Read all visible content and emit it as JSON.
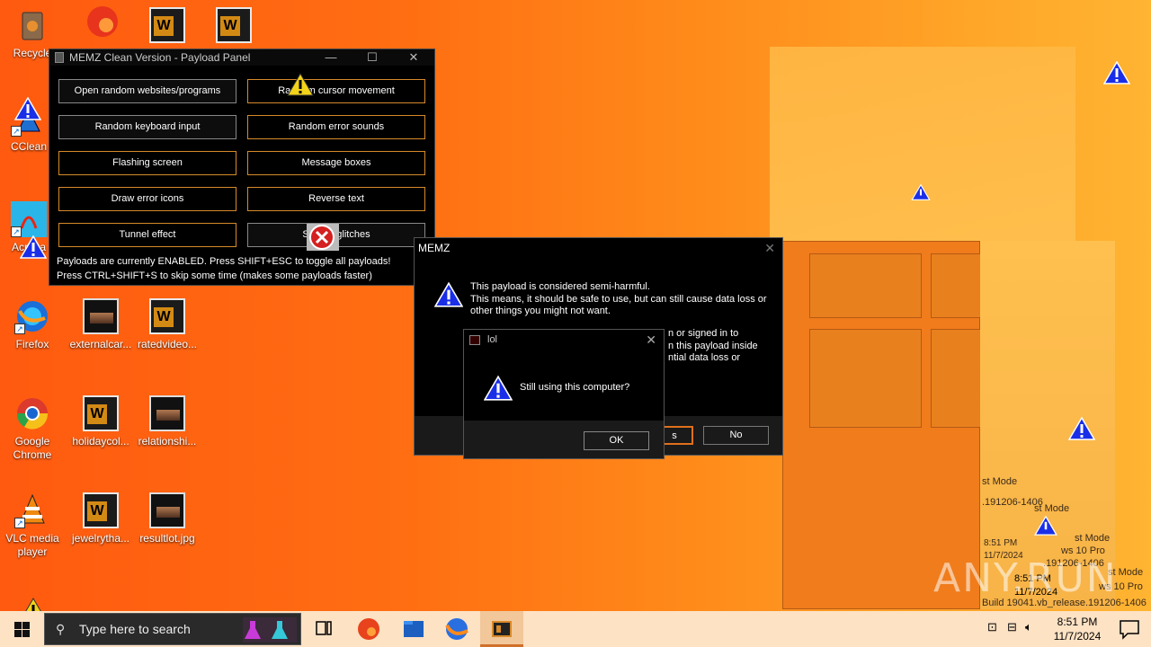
{
  "desktop": {
    "icons": [
      {
        "label": "Recycle",
        "icon": "recycle-bin-icon"
      },
      {
        "label": "CClean",
        "icon": "ccleaner-icon"
      },
      {
        "label": "Acroba",
        "icon": "acrobat-icon"
      },
      {
        "label": "Firefox",
        "icon": "firefox-icon"
      },
      {
        "label": "externalcar...",
        "icon": "image-file-icon"
      },
      {
        "label": "ratedvideo...",
        "icon": "word-doc-icon"
      },
      {
        "label": "Google Chrome",
        "icon": "chrome-icon"
      },
      {
        "label": "holidaycol...",
        "icon": "word-doc-icon"
      },
      {
        "label": "relationshi...",
        "icon": "image-file-icon"
      },
      {
        "label": "VLC media player",
        "icon": "vlc-icon"
      },
      {
        "label": "jewelrytha...",
        "icon": "word-doc-icon"
      },
      {
        "label": "resultlot.jpg",
        "icon": "image-file-icon"
      }
    ]
  },
  "panel": {
    "title": "MEMZ Clean Version - Payload Panel",
    "buttons": [
      "Open random websites/programs",
      "Random cursor movement",
      "Random keyboard input",
      "Random error sounds",
      "Flashing screen",
      "Message boxes",
      "Draw error icons",
      "Reverse text",
      "Tunnel effect",
      "Screen glitches"
    ],
    "status_line1": "Payloads are currently ENABLED. Press SHIFT+ESC to toggle all payloads!",
    "status_line2": "Press CTRL+SHIFT+S to skip some time (makes some payloads faster)"
  },
  "memz_dialog": {
    "title": "MEMZ",
    "message": "This payload is considered semi-harmful.\nThis means, it should be safe to use, but can still cause data loss or other things you might not want.",
    "message_partial": "n or signed in to\nn this payload inside\nntial data loss or",
    "yes_partial": "s",
    "no_label": "No"
  },
  "lol_dialog": {
    "title": "lol",
    "question": "Still using this computer?",
    "ok_label": "OK"
  },
  "taskbar": {
    "search_placeholder": "Type here to search",
    "time": "8:51 PM",
    "date": "11/7/2024"
  },
  "ghost_text": {
    "clock_time": "8:51 PM",
    "clock_date": "11/7/2024",
    "test_mode": "st Mode",
    "win_pro": "ws 10 Pro",
    "build": "Build 19041.vb_release.191206-1406",
    "build_short": ".191206-1406"
  },
  "watermark": "ANY.RUN"
}
